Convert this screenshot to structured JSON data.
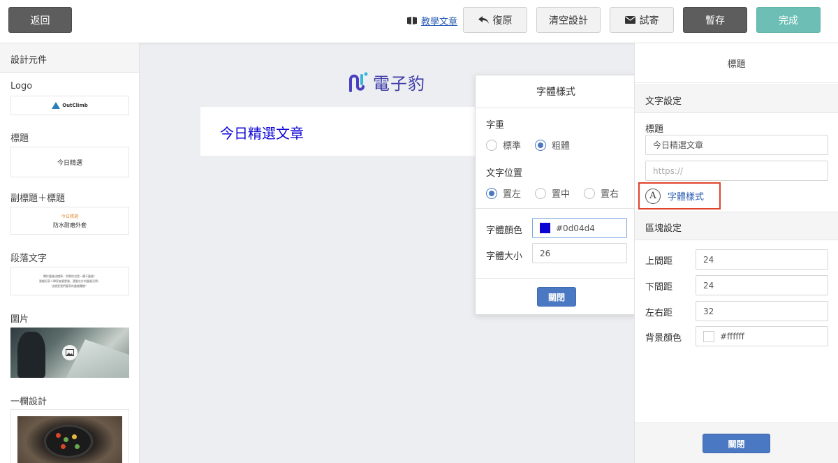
{
  "toolbar": {
    "back_label": "返回",
    "tutorial_label": "教學文章",
    "undo_label": "復原",
    "clear_label": "清空設計",
    "test_send_label": "試寄",
    "save_draft_label": "暫存",
    "done_label": "完成"
  },
  "sidebar": {
    "header": "設計元件",
    "components": [
      {
        "title": "Logo",
        "preview_text": "OutClimb"
      },
      {
        "title": "標題",
        "preview_text": "今日精選"
      },
      {
        "title": "副標題＋標題",
        "preview_small": "今日精選",
        "preview_text": "防水耐磨外套"
      },
      {
        "title": "段落文字",
        "preview_lines": [
          "關於露營這檔事，防禦的也是一種不露營！",
          "要顧好家人歸家者要野營，還要在外的露營活得，",
          "這就是我們要家的露營體驗！"
        ]
      },
      {
        "title": "圖片"
      },
      {
        "title": "一欄設計"
      }
    ]
  },
  "canvas": {
    "logo_text": "電子豹",
    "title_text": "今日精選文章",
    "title_color": "#0d04d4"
  },
  "font_popover": {
    "title": "字體樣式",
    "weight_label": "字重",
    "weight_options": [
      "標準",
      "粗體"
    ],
    "weight_selected": "粗體",
    "align_label": "文字位置",
    "align_options": [
      "置左",
      "置中",
      "置右"
    ],
    "align_selected": "置左",
    "color_label": "字體顏色",
    "color_value": "#0d04d4",
    "size_label": "字體大小",
    "size_value": "26",
    "close_label": "關閉"
  },
  "right_panel": {
    "title": "標題",
    "text_section": "文字設定",
    "title_label": "標題",
    "title_value": "今日精選文章",
    "link_placeholder": "https://",
    "font_style_link": "字體樣式",
    "block_section": "區塊設定",
    "top_padding_label": "上間距",
    "top_padding_value": "24",
    "bottom_padding_label": "下間距",
    "bottom_padding_value": "24",
    "side_padding_label": "左右距",
    "side_padding_value": "32",
    "bg_color_label": "背景顏色",
    "bg_color_value": "#ffffff",
    "close_label": "關閉"
  },
  "colors": {
    "accent_blue": "#4a78c2",
    "done_green": "#6dbfb5",
    "dark_button": "#5d5d5d",
    "highlight_red": "#e0422b"
  }
}
